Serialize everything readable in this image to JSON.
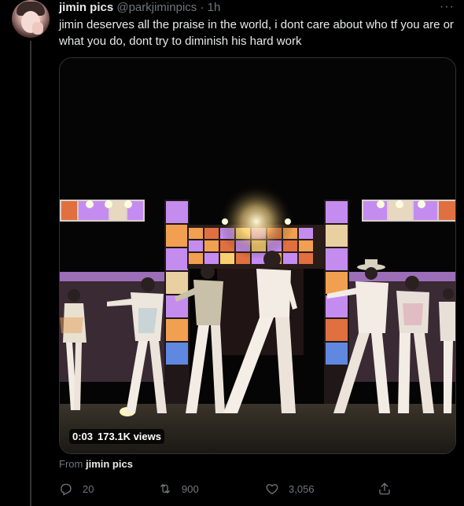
{
  "tweet": {
    "author_name": "jimin pics",
    "author_handle": "@parkjiminpics",
    "separator": "·",
    "time": "1h",
    "more_label": "···",
    "text": "jimin deserves all the praise in the world, i dont care about who tf you are or what you do, dont try to diminish his hard work",
    "video": {
      "duration": "0:03",
      "views": "173.1K views"
    },
    "from_prefix": "From",
    "from_source": "jimin pics",
    "actions": {
      "replies": "20",
      "retweets": "900",
      "likes": "3,056"
    }
  },
  "colors": {
    "background": "#000000",
    "text": "#e7e9ea",
    "muted": "#71767b",
    "stage_purple": "#c58cf0",
    "stage_orange": "#f0a050"
  },
  "icons": [
    "avatar",
    "more-icon",
    "reply-icon",
    "retweet-icon",
    "like-icon",
    "share-icon"
  ]
}
